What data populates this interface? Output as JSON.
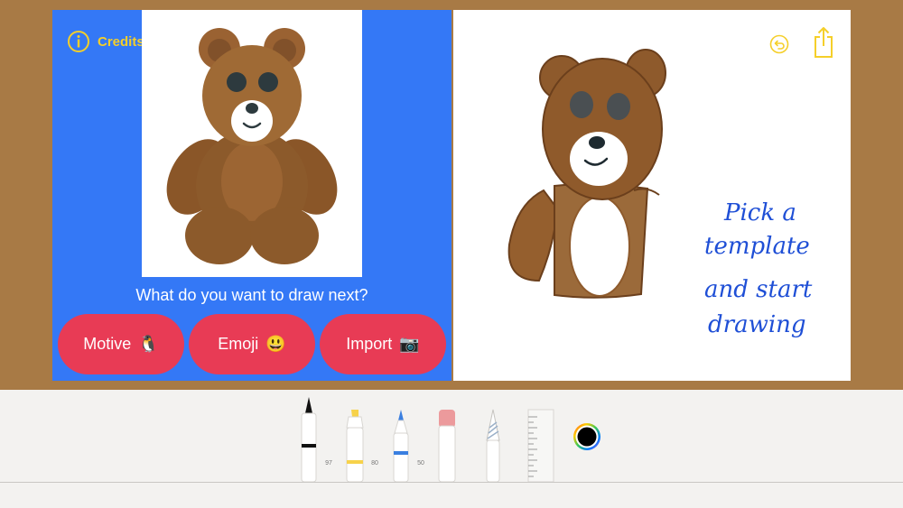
{
  "credits": {
    "label": "Credits",
    "icon": "info-icon"
  },
  "prompt": "What do you want to draw next?",
  "buttons": [
    {
      "label": "Motive",
      "emoji": "🐧"
    },
    {
      "label": "Emoji",
      "emoji": "😃"
    },
    {
      "label": "Import",
      "emoji": "📷"
    }
  ],
  "canvas": {
    "handwriting": [
      "Pick a",
      "template",
      "and start",
      "drawing"
    ],
    "undo_icon": "undo-icon",
    "share_icon": "share-icon"
  },
  "toolbar": {
    "tools": [
      {
        "name": "pen",
        "value": "97"
      },
      {
        "name": "marker",
        "value": "80"
      },
      {
        "name": "pencil-blue",
        "value": "50"
      },
      {
        "name": "eraser"
      },
      {
        "name": "lasso"
      },
      {
        "name": "ruler"
      }
    ],
    "selected_color": "#000000"
  },
  "colors": {
    "accent_yellow": "#f5cf2a",
    "panel_blue": "#3478f6",
    "button_red": "#e83b55",
    "frame_brown": "#a87a45",
    "handwriting_blue": "#1f4fd6"
  }
}
